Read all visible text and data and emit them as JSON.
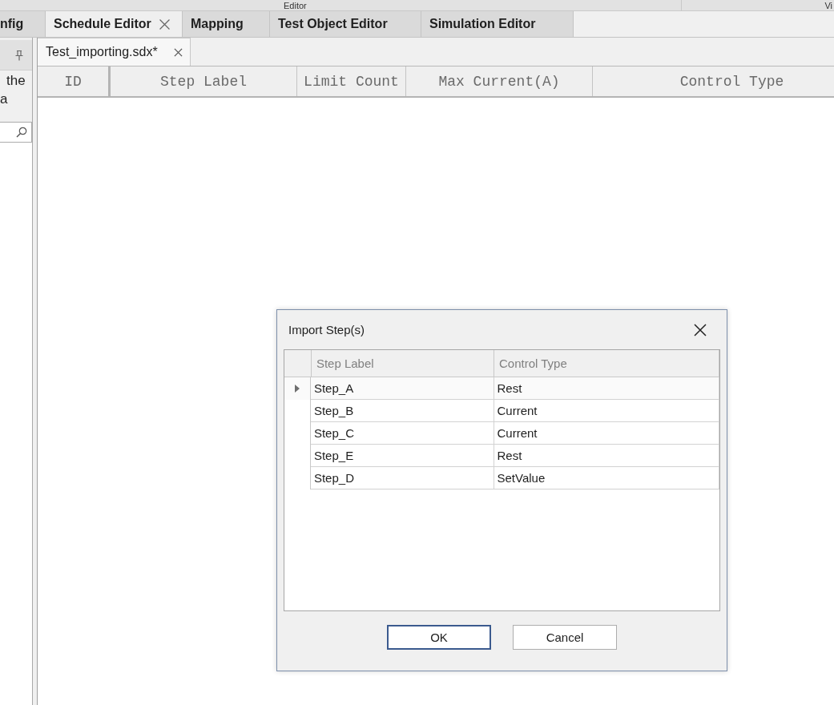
{
  "header_strip": [
    {
      "label": "Editor"
    },
    {
      "label": "Vi"
    }
  ],
  "tabs": [
    {
      "label": "nfig",
      "selected": false,
      "closable": false
    },
    {
      "label": "Schedule Editor",
      "selected": true,
      "closable": true
    },
    {
      "label": "Mapping",
      "selected": false,
      "closable": false
    },
    {
      "label": "Test Object Editor",
      "selected": false,
      "closable": false
    },
    {
      "label": "Simulation Editor",
      "selected": false,
      "closable": false
    }
  ],
  "side_panel": {
    "text_lines": [
      "the",
      "a"
    ]
  },
  "document_tabs": [
    {
      "label": "Test_importing.sdx*",
      "selected": true,
      "closable": true
    }
  ],
  "grid": {
    "columns": [
      "ID",
      "Step Label",
      "Limit Count",
      "Max Current(A)",
      "Control Type"
    ]
  },
  "dialog": {
    "title": "Import Step(s)",
    "columns": [
      "Step Label",
      "Control Type"
    ],
    "rows": [
      {
        "cells": [
          "Step_A",
          "Rest"
        ],
        "selected": true
      },
      {
        "cells": [
          "Step_B",
          "Current"
        ],
        "selected": false
      },
      {
        "cells": [
          "Step_C",
          "Current"
        ],
        "selected": false
      },
      {
        "cells": [
          "Step_E",
          "Rest"
        ],
        "selected": false
      },
      {
        "cells": [
          "Step_D",
          "SetValue"
        ],
        "selected": false
      }
    ],
    "buttons": [
      {
        "label": "OK",
        "default": true
      },
      {
        "label": "Cancel",
        "default": false
      }
    ]
  }
}
